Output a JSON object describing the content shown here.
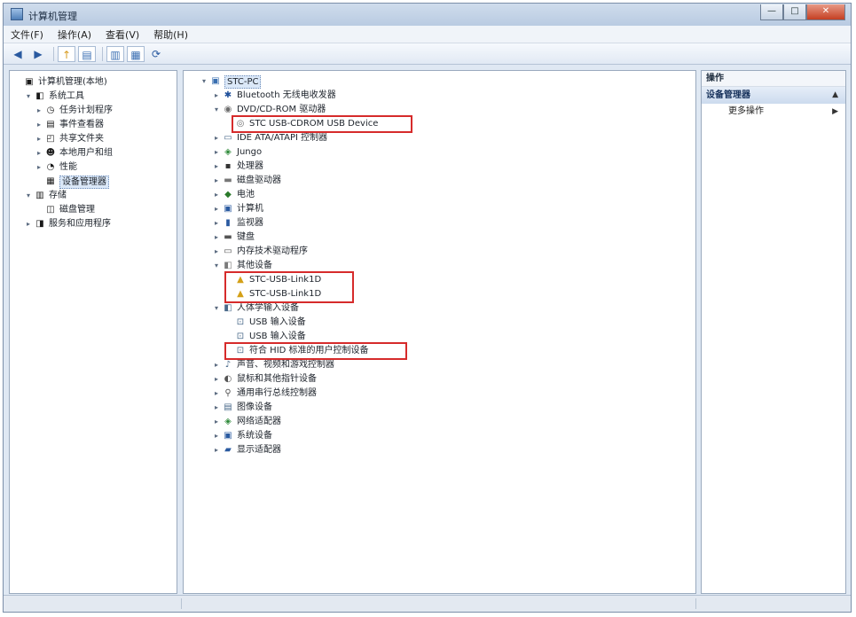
{
  "window": {
    "title": "计算机管理",
    "controls": {
      "minimize": "—",
      "maximize": "□",
      "close": "✕"
    }
  },
  "menu": [
    "文件(F)",
    "操作(A)",
    "查看(V)",
    "帮助(H)"
  ],
  "toolbar": {
    "icons": [
      "back-arrow-icon",
      "forward-arrow-icon",
      "up-folder-icon",
      "show-hide-tree-icon",
      "properties-icon",
      "help-icon",
      "refresh-icon"
    ],
    "back": "◀",
    "forward": "▶",
    "up": "↑",
    "tree": "▤",
    "props": "▥",
    "help": "▦",
    "refresh": "⟳"
  },
  "left_tree": [
    {
      "label": "计算机管理(本地)",
      "icon": "computer-management-icon",
      "glyph": "▣",
      "expander": "",
      "indent": 0
    },
    {
      "label": "系统工具",
      "icon": "system-tools-icon",
      "glyph": "◧",
      "expander": "▾",
      "indent": 1
    },
    {
      "label": "任务计划程序",
      "icon": "task-scheduler-icon",
      "glyph": "◷",
      "expander": "▸",
      "indent": 2
    },
    {
      "label": "事件查看器",
      "icon": "event-viewer-icon",
      "glyph": "▤",
      "expander": "▸",
      "indent": 2
    },
    {
      "label": "共享文件夹",
      "icon": "shared-folders-icon",
      "glyph": "◰",
      "expander": "▸",
      "indent": 2
    },
    {
      "label": "本地用户和组",
      "icon": "local-users-icon",
      "glyph": "☻",
      "expander": "▸",
      "indent": 2
    },
    {
      "label": "性能",
      "icon": "performance-icon",
      "glyph": "◔",
      "expander": "▸",
      "indent": 2
    },
    {
      "label": "设备管理器",
      "icon": "device-manager-icon",
      "glyph": "▦",
      "expander": "",
      "indent": 2
    },
    {
      "label": "存储",
      "icon": "storage-icon",
      "glyph": "▥",
      "expander": "▾",
      "indent": 1
    },
    {
      "label": "磁盘管理",
      "icon": "disk-management-icon",
      "glyph": "◫",
      "expander": "",
      "indent": 2
    },
    {
      "label": "服务和应用程序",
      "icon": "services-apps-icon",
      "glyph": "◨",
      "expander": "▸",
      "indent": 1
    }
  ],
  "device_tree": [
    {
      "label": "STC-PC",
      "icon": "computer-icon",
      "glyph": "▣",
      "expander": "▾",
      "indent": 0,
      "color": "#3a6fb0"
    },
    {
      "label": "Bluetooth 无线电收发器",
      "icon": "bluetooth-icon",
      "glyph": "✱",
      "expander": "▸",
      "indent": 1,
      "color": "#1e4f9a"
    },
    {
      "label": "DVD/CD-ROM 驱动器",
      "icon": "dvd-drive-icon",
      "glyph": "◉",
      "expander": "▾",
      "indent": 1,
      "color": "#6c6c6c"
    },
    {
      "label": "STC USB-CDROM USB Device",
      "icon": "cdrom-device-icon",
      "glyph": "◎",
      "expander": "",
      "indent": 2,
      "color": "#6c6c6c"
    },
    {
      "label": "IDE ATA/ATAPI 控制器",
      "icon": "ide-controller-icon",
      "glyph": "▭",
      "expander": "▸",
      "indent": 1,
      "color": "#4a6a8a"
    },
    {
      "label": "Jungo",
      "icon": "jungo-icon",
      "glyph": "◈",
      "expander": "▸",
      "indent": 1,
      "color": "#2f8a3a"
    },
    {
      "label": "处理器",
      "icon": "processor-icon",
      "glyph": "▪",
      "expander": "▸",
      "indent": 1,
      "color": "#333333"
    },
    {
      "label": "磁盘驱动器",
      "icon": "disk-drive-icon",
      "glyph": "▬",
      "expander": "▸",
      "indent": 1,
      "color": "#777777"
    },
    {
      "label": "电池",
      "icon": "battery-icon",
      "glyph": "◆",
      "expander": "▸",
      "indent": 1,
      "color": "#2a7a2a"
    },
    {
      "label": "计算机",
      "icon": "computer-category-icon",
      "glyph": "▣",
      "expander": "▸",
      "indent": 1,
      "color": "#2a5aa0"
    },
    {
      "label": "监视器",
      "icon": "monitor-icon",
      "glyph": "▮",
      "expander": "▸",
      "indent": 1,
      "color": "#2a5aa0"
    },
    {
      "label": "键盘",
      "icon": "keyboard-icon",
      "glyph": "▬",
      "expander": "▸",
      "indent": 1,
      "color": "#555555"
    },
    {
      "label": "内存技术驱动程序",
      "icon": "memory-tech-icon",
      "glyph": "▭",
      "expander": "▸",
      "indent": 1,
      "color": "#555555"
    },
    {
      "label": "其他设备",
      "icon": "other-devices-icon",
      "glyph": "◧",
      "expander": "▾",
      "indent": 1,
      "color": "#7a7a7a"
    },
    {
      "label": "STC-USB-Link1D",
      "icon": "unknown-device-warning-icon",
      "glyph": "▲",
      "expander": "",
      "indent": 2,
      "color": "#d4a017"
    },
    {
      "label": "STC-USB-Link1D",
      "icon": "unknown-device-warning-icon",
      "glyph": "▲",
      "expander": "",
      "indent": 2,
      "color": "#d4a017"
    },
    {
      "label": "人体学输入设备",
      "icon": "hid-icon",
      "glyph": "◧",
      "expander": "▾",
      "indent": 1,
      "color": "#4a6a8a"
    },
    {
      "label": "USB 输入设备",
      "icon": "usb-input-device-icon",
      "glyph": "⊡",
      "expander": "",
      "indent": 2,
      "color": "#4a6a8a"
    },
    {
      "label": "USB 输入设备",
      "icon": "usb-input-device-icon",
      "glyph": "⊡",
      "expander": "",
      "indent": 2,
      "color": "#4a6a8a"
    },
    {
      "label": "符合 HID 标准的用户控制设备",
      "icon": "hid-consumer-control-icon",
      "glyph": "⊡",
      "expander": "",
      "indent": 2,
      "color": "#4a6a8a"
    },
    {
      "label": "声音、视频和游戏控制器",
      "icon": "sound-video-icon",
      "glyph": "♪",
      "expander": "▸",
      "indent": 1,
      "color": "#4a6a8a"
    },
    {
      "label": "鼠标和其他指针设备",
      "icon": "mouse-icon",
      "glyph": "◐",
      "expander": "▸",
      "indent": 1,
      "color": "#555555"
    },
    {
      "label": "通用串行总线控制器",
      "icon": "usb-controller-icon",
      "glyph": "⚲",
      "expander": "▸",
      "indent": 1,
      "color": "#555555"
    },
    {
      "label": "图像设备",
      "icon": "imaging-device-icon",
      "glyph": "▤",
      "expander": "▸",
      "indent": 1,
      "color": "#4a6a8a"
    },
    {
      "label": "网络适配器",
      "icon": "network-adapter-icon",
      "glyph": "◈",
      "expander": "▸",
      "indent": 1,
      "color": "#2f8a3a"
    },
    {
      "label": "系统设备",
      "icon": "system-devices-icon",
      "glyph": "▣",
      "expander": "▸",
      "indent": 1,
      "color": "#2a5aa0"
    },
    {
      "label": "显示适配器",
      "icon": "display-adapter-icon",
      "glyph": "▰",
      "expander": "▸",
      "indent": 1,
      "color": "#2a5aa0"
    }
  ],
  "actions": {
    "header": "操作",
    "section": "设备管理器",
    "section_arrow": "▲",
    "item": "更多操作",
    "item_arrow": "▶"
  },
  "highlight_color": "#d62b2b"
}
